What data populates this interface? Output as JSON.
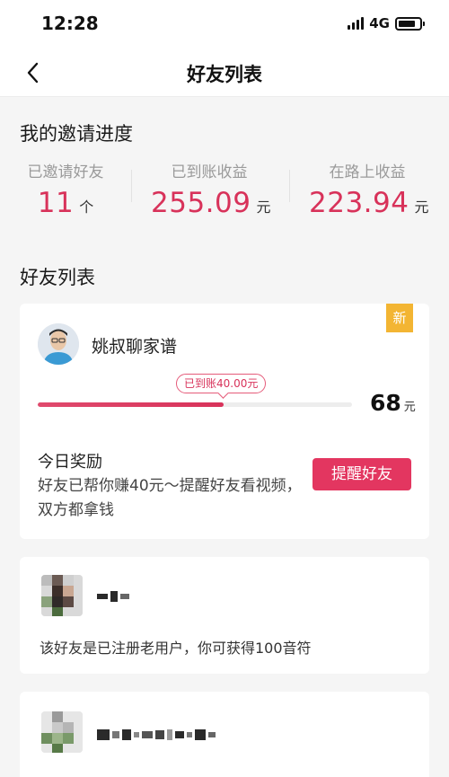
{
  "status_bar": {
    "time": "12:28",
    "network": "4G",
    "icons": [
      "signal-icon",
      "battery-icon"
    ]
  },
  "nav": {
    "title": "好友列表",
    "back_icon": "chevron-left-icon"
  },
  "invite_progress": {
    "title": "我的邀请进度",
    "stats": [
      {
        "label": "已邀请好友",
        "value": "11",
        "unit": "个"
      },
      {
        "label": "已到账收益",
        "value": "255.09",
        "unit": "元"
      },
      {
        "label": "在路上收益",
        "value": "223.94",
        "unit": "元"
      }
    ]
  },
  "friend_list": {
    "title": "好友列表",
    "friends": [
      {
        "name": "姚叔聊家谱",
        "badge": "新",
        "credited_label": "已到账40.00元",
        "progress_fraction": 0.59,
        "reward_value": "68",
        "reward_unit": "元",
        "today_label": "今日奖励",
        "today_desc": "好友已帮你赚40元～提醒好友看视频，双方都拿钱",
        "remind_button": "提醒好友"
      },
      {
        "name": "",
        "message": "该好友是已注册老用户，你可获得100音符"
      },
      {
        "name": "",
        "message": ""
      }
    ]
  },
  "colors": {
    "accent": "#d8325a",
    "button": "#e33660",
    "badge": "#f3b533",
    "background": "#f5f5f5"
  }
}
